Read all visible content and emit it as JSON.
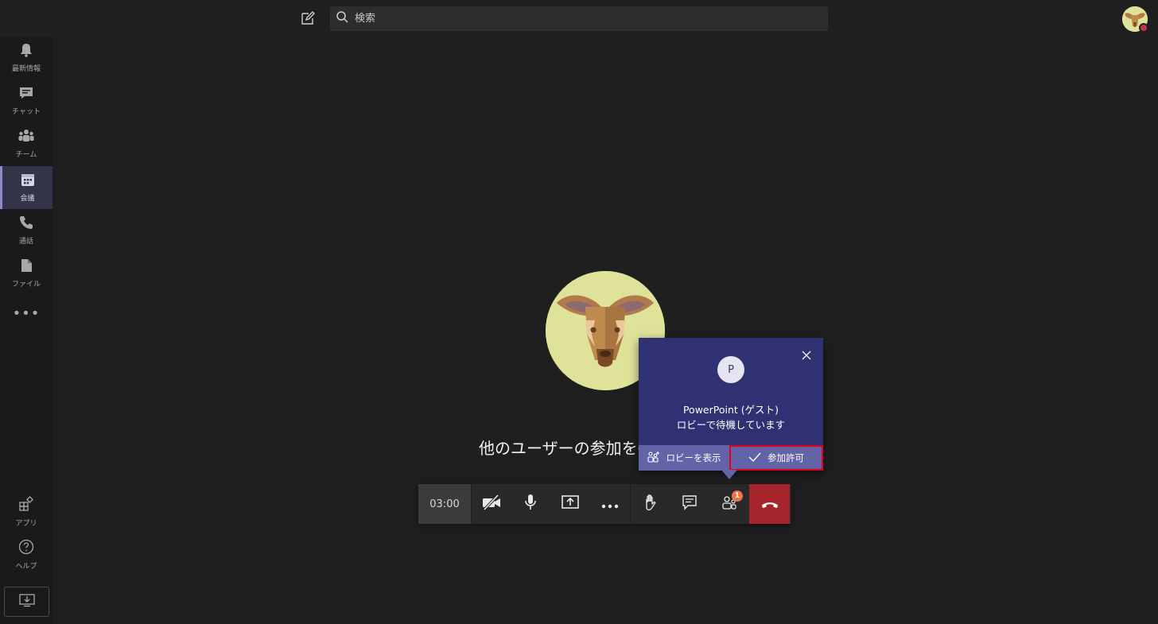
{
  "header": {
    "compose_icon": "compose-icon",
    "search_placeholder": "検索"
  },
  "rail": {
    "items": [
      {
        "label": "最新情報",
        "icon": "bell-icon"
      },
      {
        "label": "チャット",
        "icon": "chat-icon"
      },
      {
        "label": "チーム",
        "icon": "teams-icon"
      },
      {
        "label": "会議",
        "icon": "calendar-icon"
      },
      {
        "label": "通話",
        "icon": "phone-icon"
      },
      {
        "label": "ファイル",
        "icon": "file-icon"
      },
      {
        "label": "アプリ",
        "icon": "apps-icon"
      },
      {
        "label": "ヘルプ",
        "icon": "help-icon"
      }
    ],
    "more": "•••"
  },
  "stage": {
    "waiting_text": "他のユーザーの参加を待っています"
  },
  "callbar": {
    "timer": "03:00",
    "participants_badge": "1"
  },
  "lobby_popup": {
    "avatar_initial": "P",
    "name": "PowerPoint (ゲスト)",
    "status": "ロビーで待機しています",
    "view_lobby_label": "ロビーを表示",
    "admit_label": "参加許可"
  },
  "colors": {
    "accent": "#6264a7",
    "popup_bg": "#2f3173",
    "hangup": "#a4262c",
    "badge": "#e97548",
    "highlight_border": "#e3001b"
  }
}
